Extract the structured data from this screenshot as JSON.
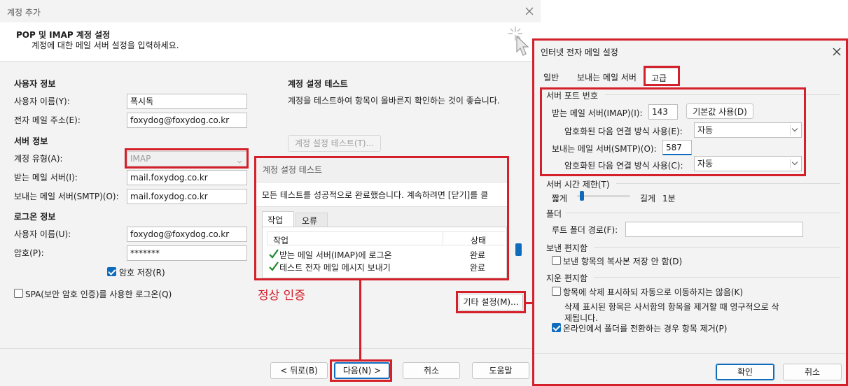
{
  "main": {
    "title": "계정 추가",
    "header_title": "POP 및 IMAP 계정 설정",
    "header_subtitle": "계정에 대한 메일 서버 설정을 입력하세요.",
    "user_info": {
      "title": "사용자 정보",
      "name_label": "사용자 이름(Y):",
      "name_value": "폭시독",
      "email_label": "전자 메일 주소(E):",
      "email_value": "foxydog@foxydog.co.kr"
    },
    "server_info": {
      "title": "서버 정보",
      "account_type_label": "계정 유형(A):",
      "account_type_value": "IMAP",
      "incoming_label": "받는 메일 서버(I):",
      "incoming_value": "mail.foxydog.co.kr",
      "outgoing_label": "보내는 메일 서버(SMTP)(O):",
      "outgoing_value": "mail.foxydog.co.kr"
    },
    "logon_info": {
      "title": "로그온 정보",
      "username_label": "사용자 이름(U):",
      "username_value": "foxydog@foxydog.co.kr",
      "password_label": "암호(P):",
      "password_value": "*******",
      "remember_password_label": "암호 저장(R)",
      "spa_label": "SPA(보안 암호 인증)를 사용한 로그온(Q)"
    },
    "test": {
      "title": "계정 설정 테스트",
      "desc": "계정을 테스트하여 항목이 올바른지 확인하는 것이 좋습니다.",
      "button": "계정 설정 테스트(T)..."
    },
    "more_settings": "기타 설정(M)...",
    "annotation": "정상 인증",
    "buttons": {
      "back": "< 뒤로(B)",
      "next": "다음(N) >",
      "cancel": "취소",
      "help": "도움말"
    }
  },
  "test_popup": {
    "title": "계정 설정 테스트",
    "message": "모든 테스트를 성공적으로 완료했습니다. 계속하려면 [닫기]를 클",
    "tabs": [
      "작업",
      "오류"
    ],
    "columns": [
      "작업",
      "상태"
    ],
    "rows": [
      {
        "task": "받는 메일 서버(IMAP)에 로그온",
        "status": "완료"
      },
      {
        "task": "테스트 전자 메일 메시지 보내기",
        "status": "완료"
      }
    ]
  },
  "settings": {
    "title": "인터넷 전자 메일 설정",
    "tabs": [
      "일반",
      "보내는 메일 서버",
      "고급"
    ],
    "ports": {
      "title": "서버 포트 번호",
      "incoming_label": "받는 메일 서버(IMAP)(I):",
      "incoming_value": "143",
      "default_button": "기본값 사용(D)",
      "incoming_enc_label": "암호화된 다음 연결 방식 사용(E):",
      "incoming_enc_value": "자동",
      "outgoing_label": "보내는 메일 서버(SMTP)(O):",
      "outgoing_value": "587",
      "outgoing_enc_label": "암호화된 다음 연결 방식 사용(C):",
      "outgoing_enc_value": "자동"
    },
    "timeout": {
      "title": "서버 시간 제한(T)",
      "short": "짧게",
      "long": "길게",
      "value": "1분",
      "slider_level": 0.05
    },
    "folders": {
      "title": "폴더",
      "root_label": "루트 폴더 경로(F):",
      "root_value": ""
    },
    "sent": {
      "title": "보낸 편지함",
      "no_copy_label": "보낸 항목의 복사본 저장 안 함(D)"
    },
    "deleted": {
      "title": "지운 편지함",
      "mark_label": "항목에 삭제 표시하되 자동으로 이동하지는 않음(K)",
      "mark_note_1": "삭제 표시된 항목은 사서함의 항목을 제거할 때 영구적으로 삭",
      "mark_note_2": "제됩니다.",
      "purge_label": "온라인에서 폴더를 전환하는 경우 항목 제거(P)"
    },
    "ok": "확인",
    "cancel": "취소"
  }
}
